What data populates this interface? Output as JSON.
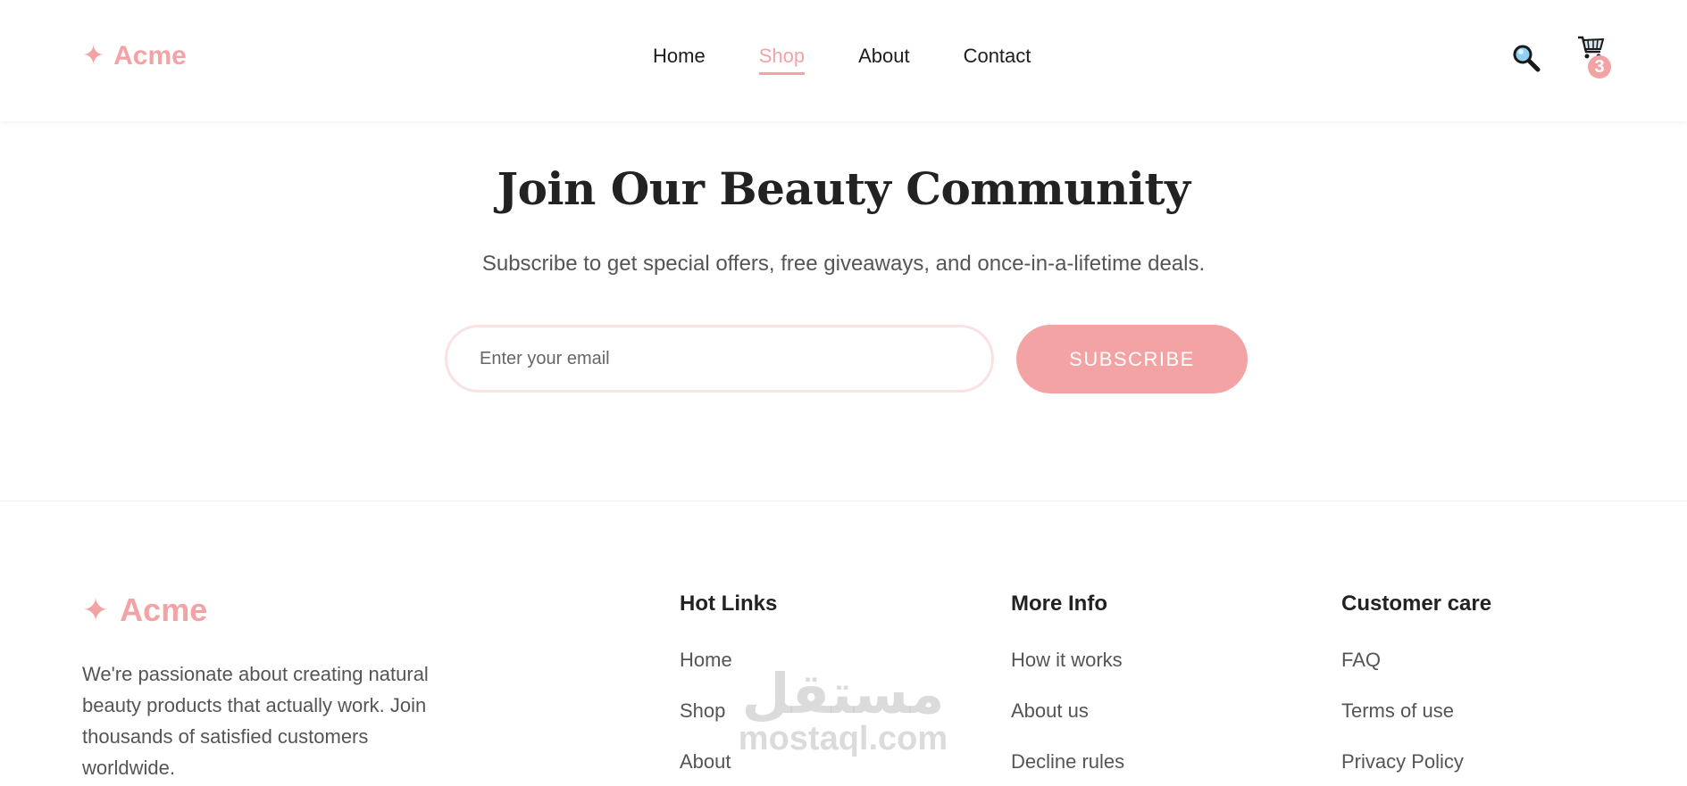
{
  "header": {
    "brand": "Acme",
    "nav": [
      {
        "label": "Home"
      },
      {
        "label": "Shop"
      },
      {
        "label": "About"
      },
      {
        "label": "Contact"
      }
    ],
    "cart_count": "3"
  },
  "newsletter": {
    "title": "Join Our Beauty Community",
    "subtitle": "Subscribe to get special offers, free giveaways, and once-in-a-lifetime deals.",
    "email_placeholder": "Enter your email",
    "button_label": "SUBSCRIBE"
  },
  "footer": {
    "brand": "Acme",
    "about": "We're passionate about creating natural beauty products that actually work. Join thousands of satisfied customers worldwide.",
    "columns": [
      {
        "title": "Hot Links",
        "links": [
          "Home",
          "Shop",
          "About"
        ]
      },
      {
        "title": "More Info",
        "links": [
          "How it works",
          "About us",
          "Decline rules"
        ]
      },
      {
        "title": "Customer care",
        "links": [
          "FAQ",
          "Terms of use",
          "Privacy Policy"
        ]
      }
    ]
  },
  "watermark": {
    "arabic": "مستقل",
    "latin": "mostaql.com"
  },
  "colors": {
    "accent": "#f4a3a5",
    "text_dark": "#222222",
    "text_muted": "#555555"
  },
  "icons": [
    "sparkle-icon",
    "search-icon",
    "cart-icon"
  ]
}
